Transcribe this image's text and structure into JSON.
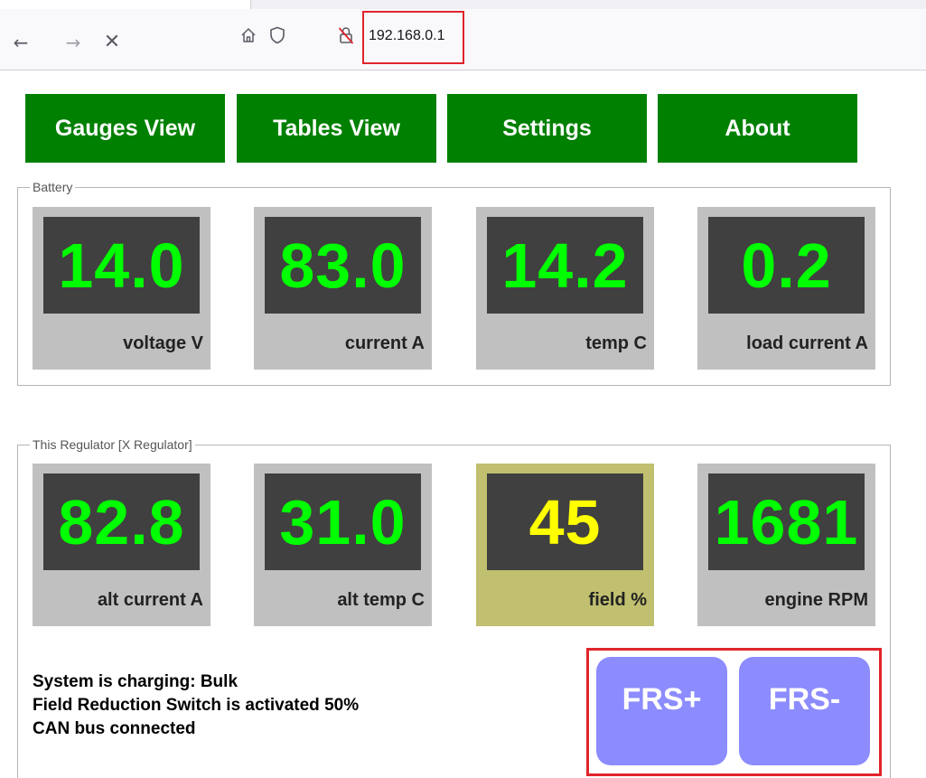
{
  "browser": {
    "url": "192.168.0.1",
    "icons": [
      "back-arrow-icon",
      "forward-arrow-icon",
      "stop-icon",
      "home-icon",
      "shield-icon",
      "insecure-lock-icon"
    ],
    "back_glyph": "←",
    "forward_glyph": "→",
    "stop_glyph": "✕",
    "highlight_color": "#e0242c"
  },
  "nav": {
    "tabs": [
      {
        "label": "Gauges View"
      },
      {
        "label": "Tables View"
      },
      {
        "label": "Settings"
      },
      {
        "label": "About"
      }
    ],
    "color": "#008000"
  },
  "battery": {
    "legend": "Battery",
    "gauges": [
      {
        "value": "14.0",
        "label": "voltage V"
      },
      {
        "value": "83.0",
        "label": "current A"
      },
      {
        "value": "14.2",
        "label": "temp C"
      },
      {
        "value": "0.2",
        "label": "load current A"
      }
    ]
  },
  "regulator": {
    "legend": "This Regulator [X Regulator]",
    "gauges": [
      {
        "value": "82.8",
        "label": "alt current A"
      },
      {
        "value": "31.0",
        "label": "alt temp C"
      },
      {
        "value": "45",
        "label": "field %"
      },
      {
        "value": "1681",
        "label": "engine RPM"
      }
    ]
  },
  "status": {
    "lines": [
      "System is charging: Bulk",
      "Field Reduction Switch is activated 50%",
      "CAN bus connected"
    ]
  },
  "frs": {
    "plus_label": "FRS+",
    "minus_label": "FRS-",
    "color": "#8c8cff"
  },
  "colors": {
    "gauge_ok_text": "#00ff00",
    "gauge_warn_text": "#ffff00",
    "gauge_bg": "#c0c0c0",
    "gauge_warn_bg": "#c0c070",
    "screen_bg": "#404040"
  }
}
